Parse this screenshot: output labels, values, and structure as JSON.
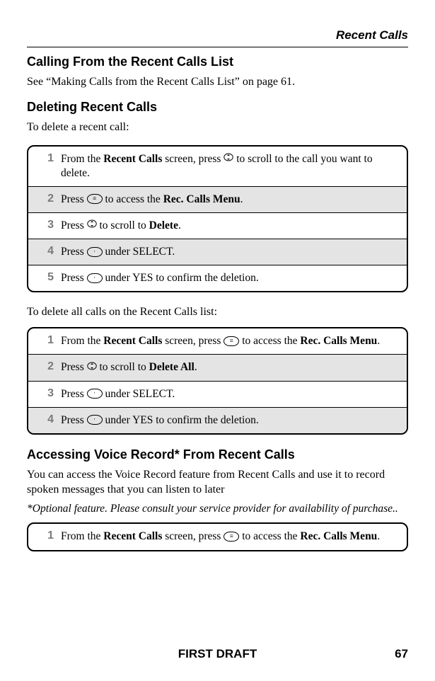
{
  "header": {
    "right": "Recent Calls"
  },
  "sectionA": {
    "heading": "Calling From the Recent Calls List",
    "body": "See “Making Calls from the Recent Calls List” on page 61."
  },
  "sectionB": {
    "heading": "Deleting Recent Calls",
    "intro": "To delete a recent call:",
    "steps": [
      {
        "n": "1",
        "text_before": "From the ",
        "bold1": "Recent Calls",
        "mid1": " screen, press ",
        "glyph": "scroll-v",
        "after": " to scroll to the call you want to delete."
      },
      {
        "n": "2",
        "even": true,
        "text_before": "Press ",
        "glyph": "menu-key",
        "mid1": " to access the ",
        "bold1": "Rec. Calls Menu",
        "after": "."
      },
      {
        "n": "3",
        "text_before": "Press ",
        "glyph": "scroll-v",
        "mid1": " to scroll to ",
        "bold1": "Delete",
        "after": "."
      },
      {
        "n": "4",
        "even": true,
        "text_before": "Press ",
        "glyph": "soft-key",
        "after": " under SELECT."
      },
      {
        "n": "5",
        "text_before": "Press ",
        "glyph": "soft-key",
        "after": " under YES to confirm the deletion."
      }
    ],
    "intro2": "To delete all calls on the Recent Calls list:",
    "steps2": [
      {
        "n": "1",
        "text_before": "From the ",
        "bold1": "Recent Calls",
        "mid1": " screen, press ",
        "glyph": "menu-key",
        "mid2": " to access the ",
        "bold2": "Rec. Calls Menu",
        "after": "."
      },
      {
        "n": "2",
        "even": true,
        "text_before": "Press ",
        "glyph": "scroll-v",
        "mid1": " to scroll to ",
        "bold1": "Delete All",
        "after": "."
      },
      {
        "n": "3",
        "text_before": "Press ",
        "glyph": "soft-key",
        "after": " under SELECT."
      },
      {
        "n": "4",
        "even": true,
        "text_before": "Press ",
        "glyph": "soft-key",
        "after": " under YES to confirm the deletion."
      }
    ]
  },
  "sectionC": {
    "heading": "Accessing Voice Record* From Recent Calls",
    "body": "You can access the Voice Record feature from Recent Calls and use it to record spoken messages that you can listen to later",
    "note": "*Optional feature. Please consult your service provider for availability of purchase..",
    "steps": [
      {
        "n": "1",
        "text_before": "From the ",
        "bold1": "Recent Calls",
        "mid1": " screen, press ",
        "glyph": "menu-key",
        "mid2": " to access the ",
        "bold2": "Rec. Calls Menu",
        "after": "."
      }
    ]
  },
  "footer": {
    "center": "FIRST DRAFT",
    "right": "67"
  }
}
